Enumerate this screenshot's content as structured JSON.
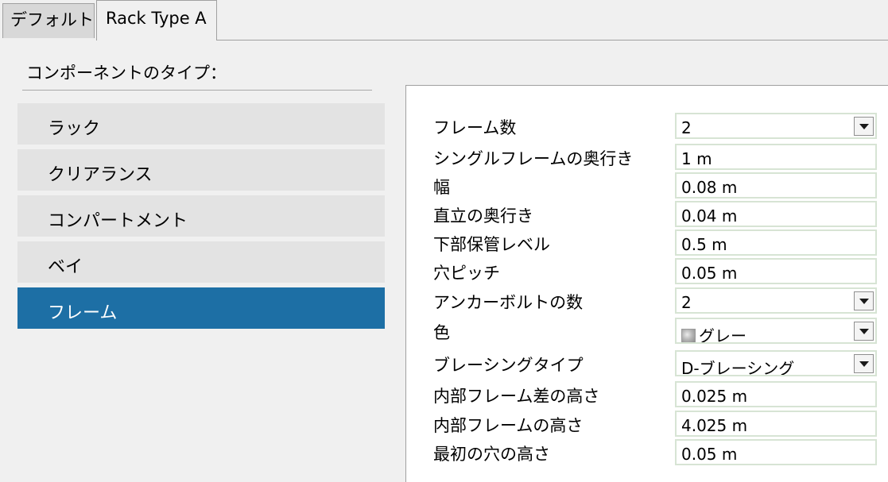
{
  "tabs": [
    {
      "label": "デフォルト",
      "active": false
    },
    {
      "label": "Rack Type A",
      "active": true
    }
  ],
  "component_type_label": "コンポーネントのタイプ：",
  "components": [
    {
      "label": "ラック",
      "selected": false
    },
    {
      "label": "クリアランス",
      "selected": false
    },
    {
      "label": "コンパートメント",
      "selected": false
    },
    {
      "label": "ベイ",
      "selected": false
    },
    {
      "label": "フレーム",
      "selected": true
    }
  ],
  "properties": [
    {
      "label": "フレーム数",
      "value": "2",
      "type": "dropdown"
    },
    {
      "label": "シングルフレームの奥行き",
      "value": "1 m",
      "type": "text"
    },
    {
      "label": "幅",
      "value": "0.08 m",
      "type": "text"
    },
    {
      "label": "直立の奥行き",
      "value": "0.04 m",
      "type": "text"
    },
    {
      "label": "下部保管レベル",
      "value": "0.5 m",
      "type": "text"
    },
    {
      "label": "穴ピッチ",
      "value": "0.05 m",
      "type": "text"
    },
    {
      "label": "アンカーボルトの数",
      "value": "2",
      "type": "dropdown"
    },
    {
      "label": "色",
      "value": "グレー",
      "type": "dropdown",
      "swatch": true
    },
    {
      "label": "ブレーシングタイプ",
      "value": "D-ブレーシング",
      "type": "dropdown"
    },
    {
      "label": "内部フレーム差の高さ",
      "value": "0.025 m",
      "type": "text"
    },
    {
      "label": "内部フレームの高さ",
      "value": "4.025 m",
      "type": "text"
    },
    {
      "label": "最初の穴の高さ",
      "value": "0.05 m",
      "type": "text"
    }
  ],
  "colors": {
    "selected_bg": "#1d6fa5",
    "item_bg": "#e3e3e3",
    "field_border": "#d7e4d4",
    "color_swatch": "#a6a6a6"
  }
}
